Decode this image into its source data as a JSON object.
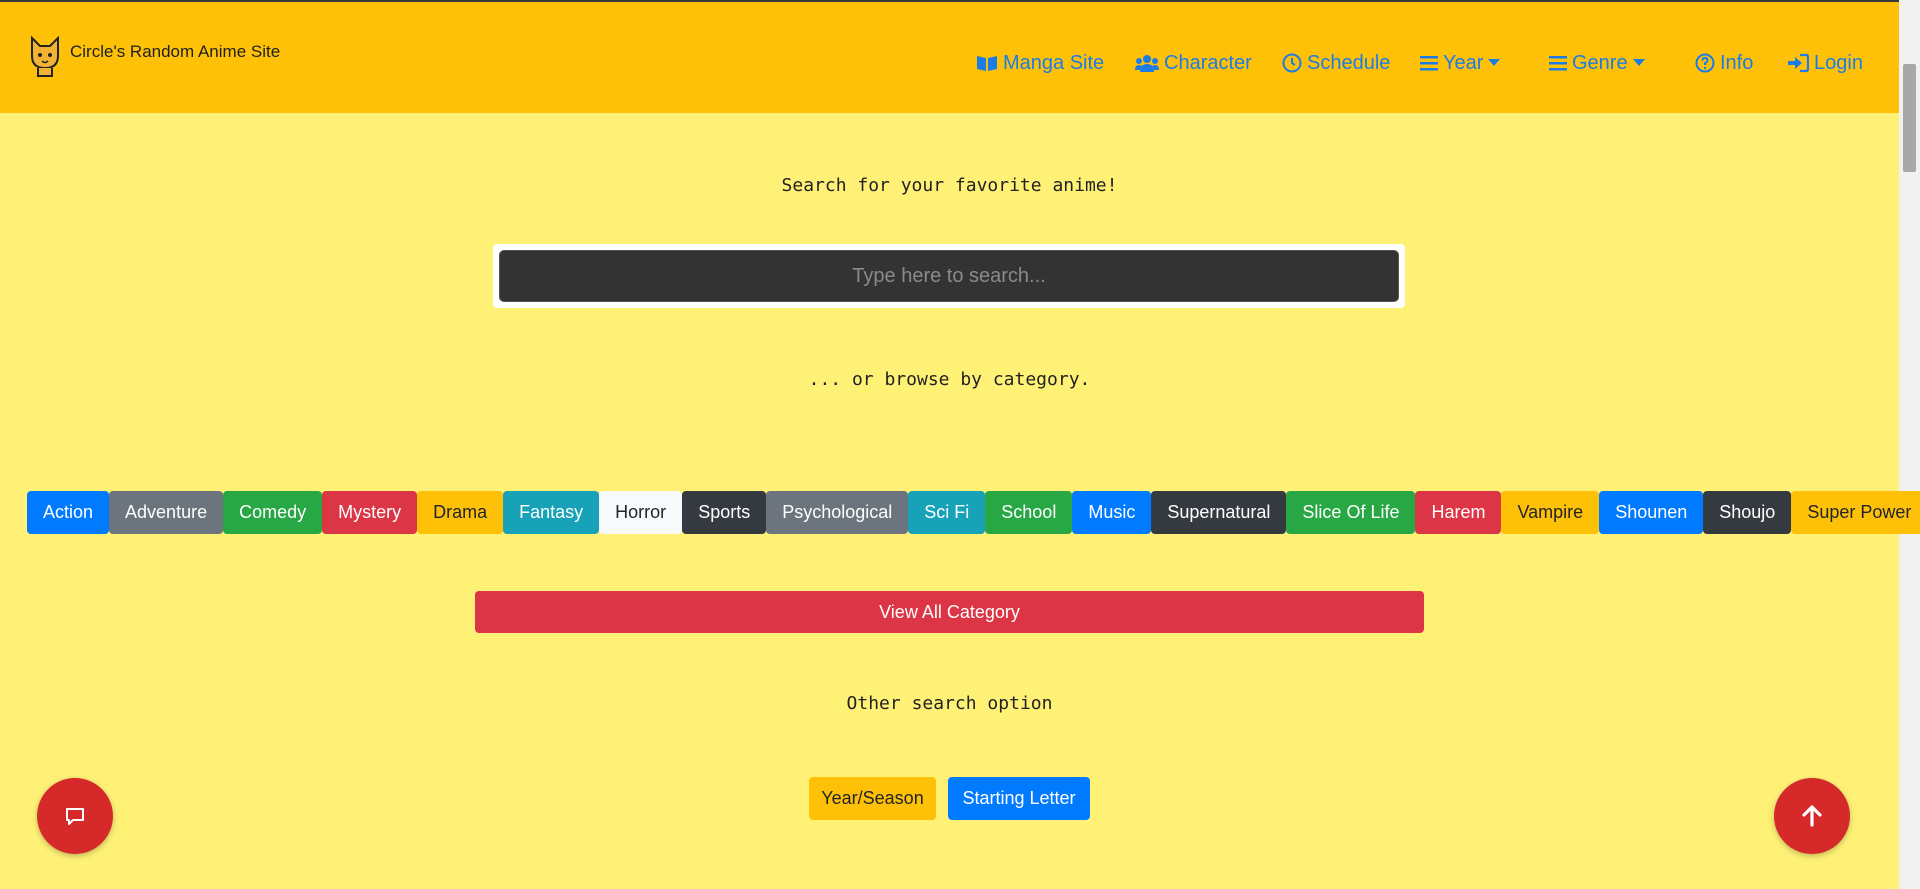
{
  "brand": {
    "name": "Circle's Random Anime Site",
    "logo_icon": "cat-icon"
  },
  "nav": {
    "manga": {
      "label": "Manga Site",
      "icon": "book-open-icon"
    },
    "character": {
      "label": "Character",
      "icon": "users-icon"
    },
    "schedule": {
      "label": "Schedule",
      "icon": "clock-icon"
    },
    "year": {
      "label": "Year",
      "icon": "menu-icon"
    },
    "genre": {
      "label": "Genre",
      "icon": "menu-icon"
    },
    "info": {
      "label": "Info",
      "icon": "question-circle-icon"
    },
    "login": {
      "label": "Login",
      "icon": "sign-in-icon"
    }
  },
  "main": {
    "heading": "Search for your favorite anime!",
    "search_placeholder": "Type here to search...",
    "search_value": "",
    "browse_text": "... or browse by category.",
    "view_all_label": "View All Category",
    "other_search_title": "Other search option"
  },
  "genres": [
    {
      "label": "Action",
      "bg": "#007bff",
      "fg": "#ffffff"
    },
    {
      "label": "Adventure",
      "bg": "#6c757d",
      "fg": "#ffffff"
    },
    {
      "label": "Comedy",
      "bg": "#28a745",
      "fg": "#ffffff"
    },
    {
      "label": "Mystery",
      "bg": "#dc3545",
      "fg": "#ffffff"
    },
    {
      "label": "Drama",
      "bg": "#ffc107",
      "fg": "#212529"
    },
    {
      "label": "Fantasy",
      "bg": "#17a2b8",
      "fg": "#ffffff"
    },
    {
      "label": "Horror",
      "bg": "#f8f9fa",
      "fg": "#212529"
    },
    {
      "label": "Sports",
      "bg": "#343a40",
      "fg": "#ffffff"
    },
    {
      "label": "Psychological",
      "bg": "#6c757d",
      "fg": "#ffffff"
    },
    {
      "label": "Sci Fi",
      "bg": "#17a2b8",
      "fg": "#ffffff"
    },
    {
      "label": "School",
      "bg": "#28a745",
      "fg": "#ffffff"
    },
    {
      "label": "Music",
      "bg": "#007bff",
      "fg": "#ffffff"
    },
    {
      "label": "Supernatural",
      "bg": "#343a40",
      "fg": "#ffffff"
    },
    {
      "label": "Slice Of Life",
      "bg": "#28a745",
      "fg": "#ffffff"
    },
    {
      "label": "Harem",
      "bg": "#dc3545",
      "fg": "#ffffff"
    },
    {
      "label": "Vampire",
      "bg": "#ffc107",
      "fg": "#212529"
    },
    {
      "label": "Shounen",
      "bg": "#007bff",
      "fg": "#ffffff"
    },
    {
      "label": "Shoujo",
      "bg": "#343a40",
      "fg": "#ffffff"
    },
    {
      "label": "Super Power",
      "bg": "#ffc107",
      "fg": "#212529"
    }
  ],
  "options": {
    "year_season": {
      "label": "Year/Season",
      "bg": "#ffc107",
      "fg": "#212529"
    },
    "starting_letter": {
      "label": "Starting Letter",
      "bg": "#007bff",
      "fg": "#ffffff"
    }
  },
  "fabs": {
    "chat_icon": "chat-icon",
    "scroll_top_icon": "arrow-up-icon",
    "color": "#d62a2a"
  },
  "colors": {
    "navbar": "#ffc107",
    "page_bg": "#fff176",
    "nav_link": "#1c7ce6"
  }
}
